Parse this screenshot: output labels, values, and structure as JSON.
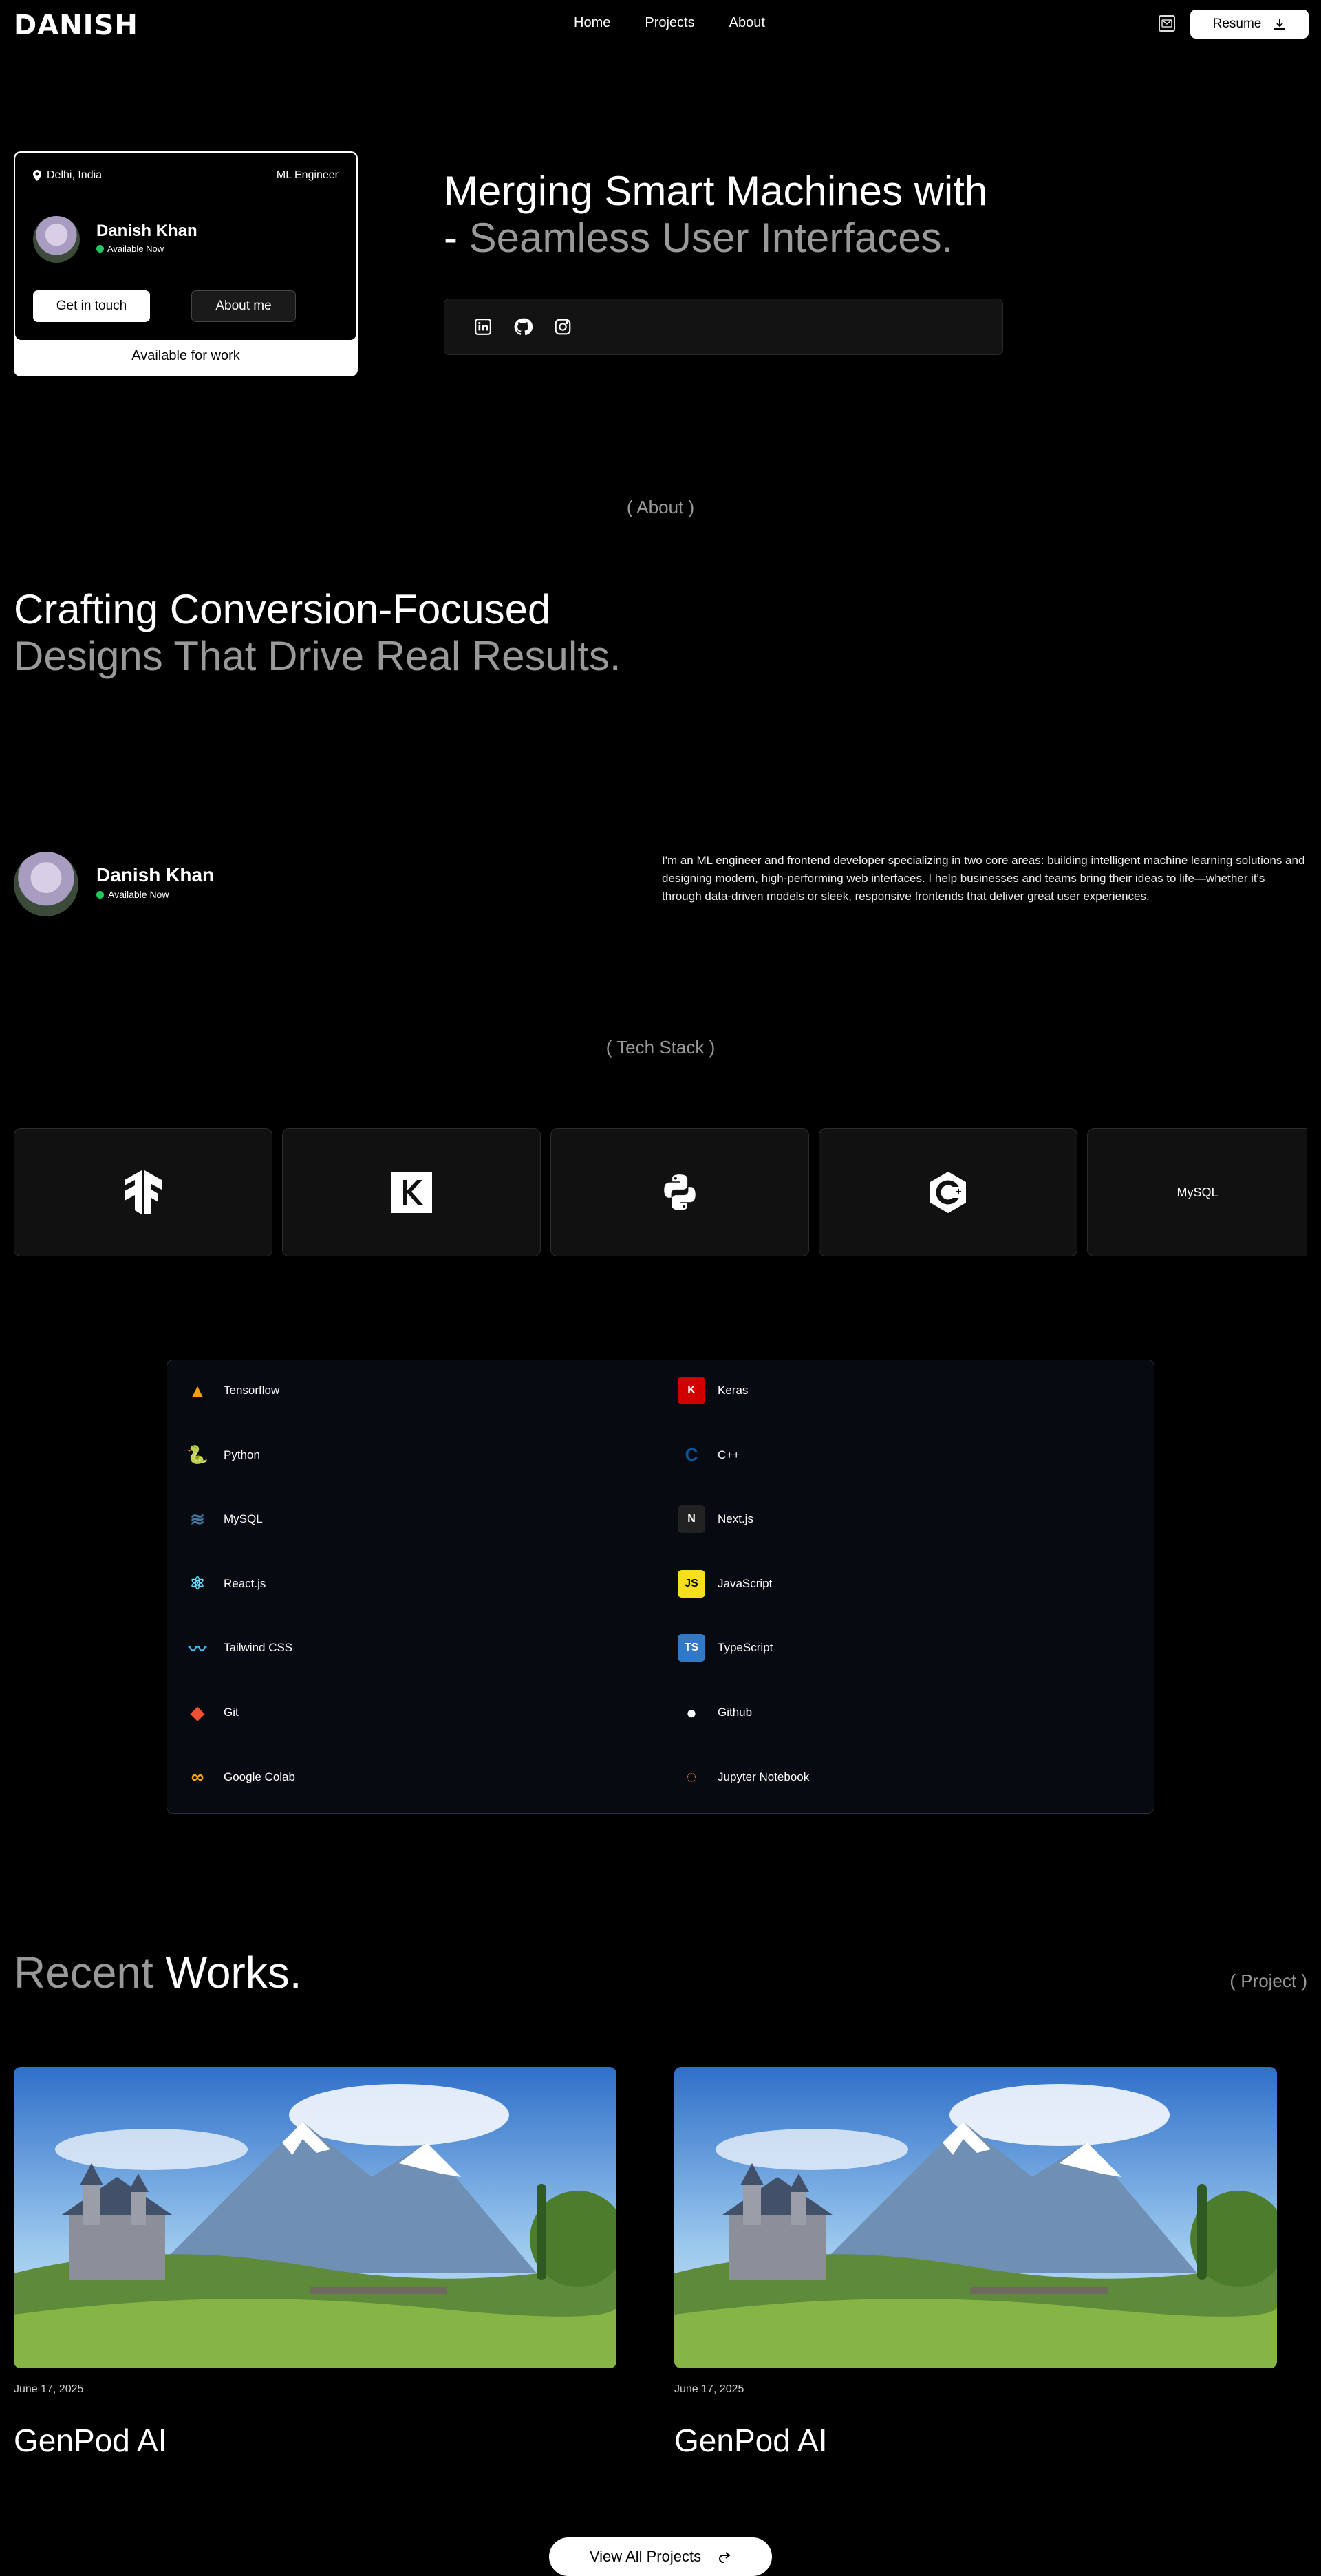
{
  "header": {
    "logo": "DANISH",
    "nav": [
      "Home",
      "Projects",
      "About"
    ],
    "resume_label": "Resume"
  },
  "profile_card": {
    "location": "Delhi, India",
    "role": "ML Engineer",
    "name": "Danish Khan",
    "status": "Available Now",
    "primary_button": "Get in touch",
    "secondary_button": "About me",
    "footer": "Available for work"
  },
  "hero": {
    "line1": "Merging Smart Machines with",
    "line2_prefix": "- ",
    "line2_accent": "Seamless User Interfaces."
  },
  "about": {
    "label": "( About )",
    "headline_1": "Crafting Conversion-Focused",
    "headline_2": "Designs That Drive Real Results.",
    "name": "Danish Khan",
    "status": "Available Now",
    "bio": "I'm an ML engineer and frontend developer specializing in two core areas: building intelligent machine learning solutions and designing modern, high-performing web interfaces. I help businesses and teams bring their ideas to life—whether it's through data-driven models or sleek, responsive frontends that deliver great user experiences."
  },
  "tech_stack": {
    "label": "( Tech Stack )",
    "tiles": [
      "tensorflow-icon",
      "keras-icon",
      "python-icon",
      "cpp-icon",
      "MySQL"
    ],
    "items": [
      {
        "name": "Tensorflow",
        "icon": "tensorflow-icon",
        "color": "#f59e0b"
      },
      {
        "name": "Keras",
        "icon": "keras-icon",
        "color": "#d00000"
      },
      {
        "name": "Python",
        "icon": "python-icon",
        "color": "#3776ab"
      },
      {
        "name": "C++",
        "icon": "cpp-icon",
        "color": "#00599c"
      },
      {
        "name": "MySQL",
        "icon": "mysql-icon",
        "color": "#4479a1"
      },
      {
        "name": "Next.js",
        "icon": "nextjs-icon",
        "color": "#222222"
      },
      {
        "name": "React.js",
        "icon": "react-icon",
        "color": "#61dafb"
      },
      {
        "name": "JavaScript",
        "icon": "javascript-icon",
        "color": "#f7df1e"
      },
      {
        "name": "Tailwind CSS",
        "icon": "tailwind-icon",
        "color": "#38bdf8"
      },
      {
        "name": "TypeScript",
        "icon": "typescript-icon",
        "color": "#3178c6"
      },
      {
        "name": "Git",
        "icon": "git-icon",
        "color": "#f05032"
      },
      {
        "name": "Github",
        "icon": "github-icon",
        "color": "#ffffff"
      },
      {
        "name": "Google Colab",
        "icon": "colab-icon",
        "color": "#f9ab00"
      },
      {
        "name": "Jupyter Notebook",
        "icon": "jupyter-icon",
        "color": "#f37626"
      }
    ]
  },
  "works": {
    "title_accent": "Recent",
    "title_rest": " Works.",
    "label": "( Project )",
    "projects": [
      {
        "date": "June 17, 2025",
        "title": "GenPod AI"
      },
      {
        "date": "June 17, 2025",
        "title": "GenPod AI"
      }
    ],
    "view_all": "View All Projects"
  }
}
